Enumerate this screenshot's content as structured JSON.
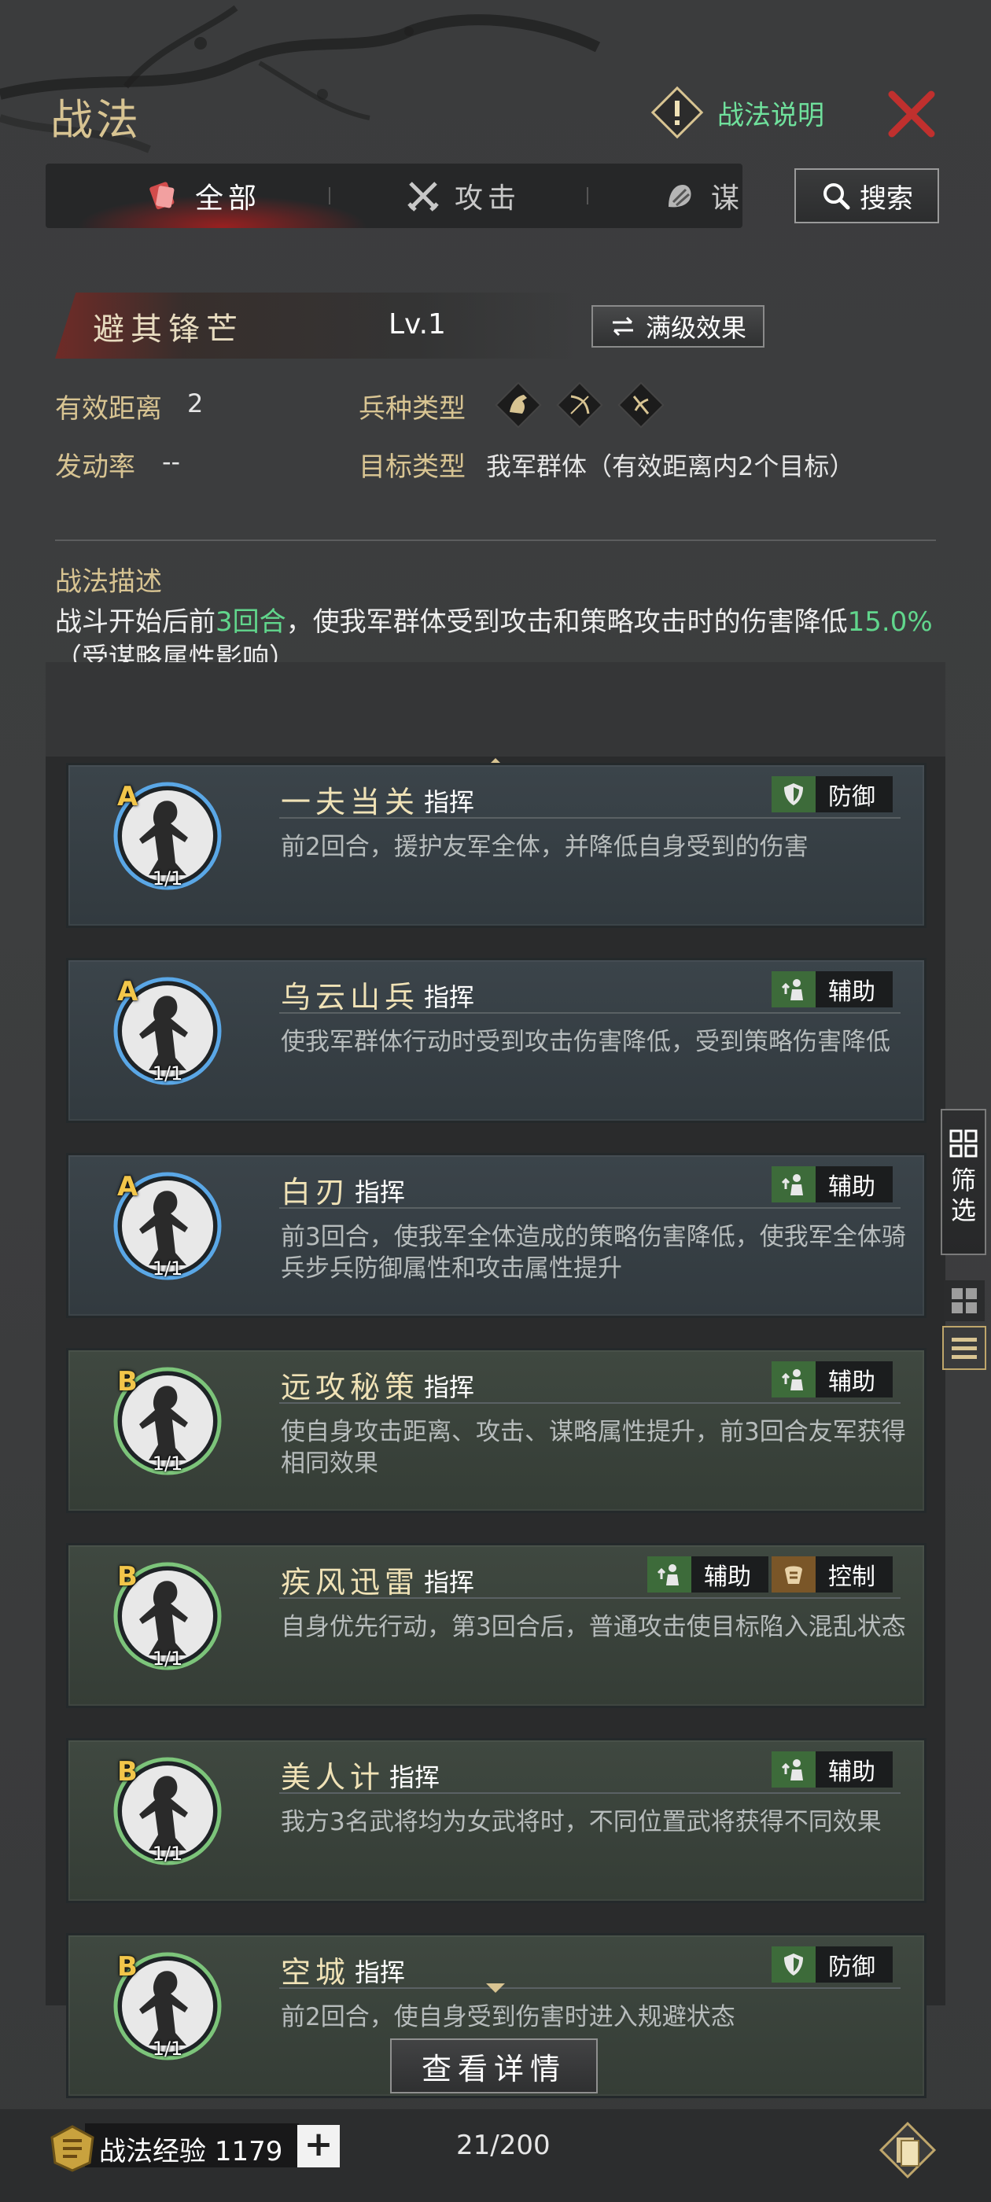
{
  "header": {
    "title": "战法",
    "help_label": "战法说明",
    "close_icon": "close-icon"
  },
  "tabs": [
    {
      "label": "全部",
      "icon": "all-icon",
      "active": true
    },
    {
      "label": "攻击",
      "icon": "swords-icon",
      "active": false
    },
    {
      "label": "谋",
      "icon": "strategy-icon",
      "active": false
    }
  ],
  "search": {
    "label": "搜索"
  },
  "skill": {
    "name": "避其锋芒",
    "level": "Lv.1",
    "max_level_button": "满级效果",
    "range_label": "有效距离",
    "range_value": "2",
    "troop_label": "兵种类型",
    "troop_icons": [
      "cavalry-icon",
      "archer-icon",
      "infantry-icon"
    ],
    "rate_label": "发动率",
    "rate_value": "--",
    "target_label": "目标类型",
    "target_value": "我军群体（有效距离内2个目标）",
    "desc_label": "战法描述",
    "desc_part1": "战斗开始后前",
    "desc_hl1": "3回合",
    "desc_part2": "，使我军群体受到攻击和策略攻击时的伤害降低",
    "desc_hl2": "15.0%",
    "desc_part3": "（受谋略属性影响）"
  },
  "list": [
    {
      "grade": "A",
      "count": "1/1",
      "name": "一夫当关",
      "type": "指挥",
      "tags": [
        {
          "label": "防御",
          "icon": "shield-icon",
          "color": "#3d6b3a"
        }
      ],
      "desc": "前2回合，援护友军全体，并降低自身受到的伤害"
    },
    {
      "grade": "A",
      "count": "1/1",
      "name": "乌云山兵",
      "type": "指挥",
      "tags": [
        {
          "label": "辅助",
          "icon": "support-icon",
          "color": "#3d6b3a"
        }
      ],
      "desc": "使我军群体行动时受到攻击伤害降低，受到策略伤害降低"
    },
    {
      "grade": "A",
      "count": "1/1",
      "name": "白刃",
      "type": "指挥",
      "tags": [
        {
          "label": "辅助",
          "icon": "support-icon",
          "color": "#3d6b3a"
        }
      ],
      "desc": "前3回合，使我军全体造成的策略伤害降低，使我军全体骑兵步兵防御属性和攻击属性提升"
    },
    {
      "grade": "B",
      "count": "1/1",
      "name": "远攻秘策",
      "type": "指挥",
      "tags": [
        {
          "label": "辅助",
          "icon": "support-icon",
          "color": "#3d6b3a"
        }
      ],
      "desc": "使自身攻击距离、攻击、谋略属性提升，前3回合友军获得相同效果"
    },
    {
      "grade": "B",
      "count": "1/1",
      "name": "疾风迅雷",
      "type": "指挥",
      "tags": [
        {
          "label": "辅助",
          "icon": "support-icon",
          "color": "#3d6b3a"
        },
        {
          "label": "控制",
          "icon": "control-icon",
          "color": "#7a5628"
        }
      ],
      "desc": "自身优先行动，第3回合后，普通攻击使目标陷入混乱状态"
    },
    {
      "grade": "B",
      "count": "1/1",
      "name": "美人计",
      "type": "指挥",
      "tags": [
        {
          "label": "辅助",
          "icon": "support-icon",
          "color": "#3d6b3a"
        }
      ],
      "desc": "我方3名武将均为女武将时，不同位置武将获得不同效果"
    },
    {
      "grade": "B",
      "count": "1/1",
      "name": "空城",
      "type": "指挥",
      "tags": [
        {
          "label": "防御",
          "icon": "shield-icon",
          "color": "#3d6b3a"
        }
      ],
      "desc": "前2回合，使自身受到伤害时进入规避状态"
    }
  ],
  "side": {
    "filter_label": "筛选",
    "grid_icon": "grid-view-icon",
    "list_icon": "list-view-icon"
  },
  "footer": {
    "detail_button": "查看详情",
    "exp_label": "战法经验",
    "exp_value": "1179",
    "plus_label": "+",
    "capacity": "21/200"
  }
}
